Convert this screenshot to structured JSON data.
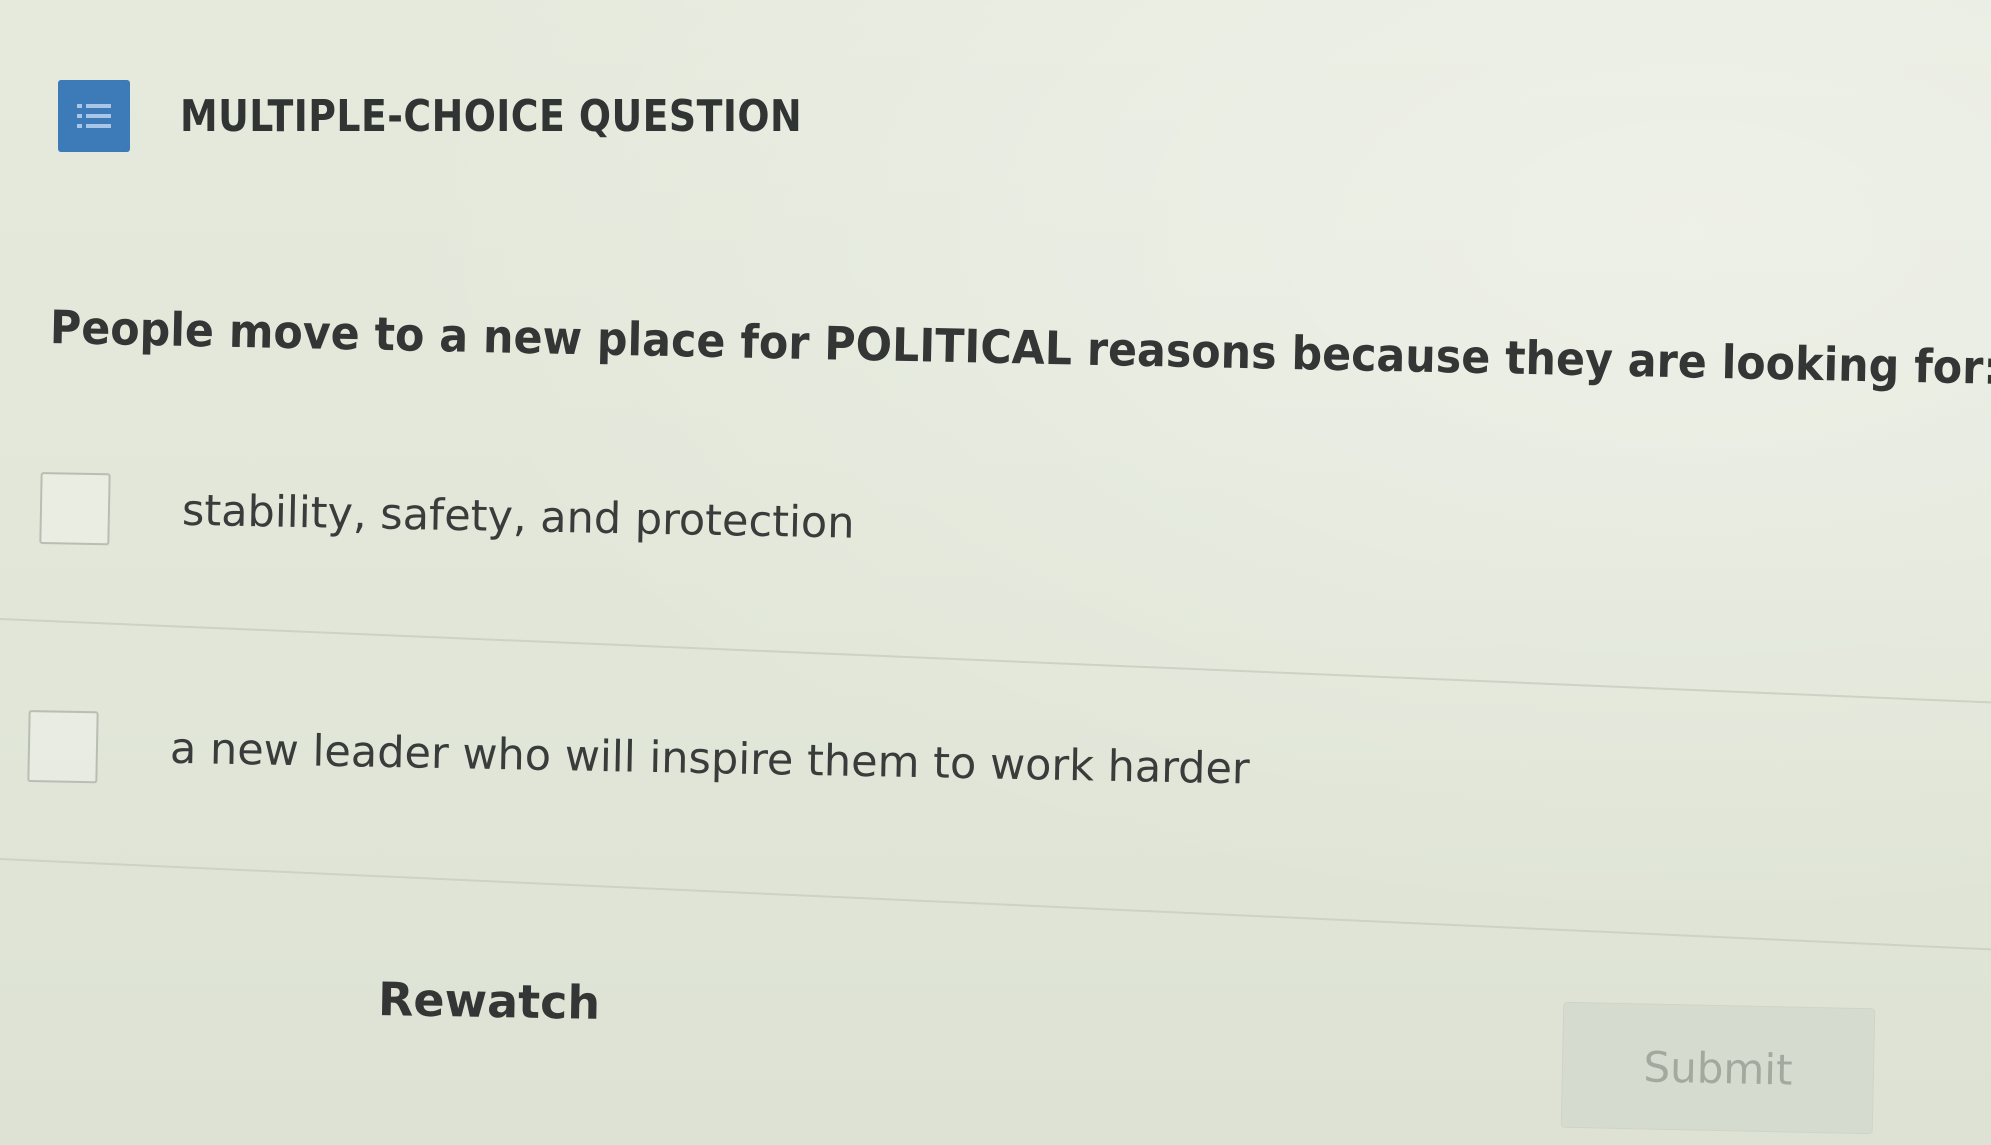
{
  "header": {
    "icon": "list-icon",
    "title": "MULTIPLE-CHOICE QUESTION"
  },
  "question": {
    "text": "People move to a new place for POLITICAL reasons because they are looking for:"
  },
  "options": [
    {
      "label": "stability, safety, and protection",
      "checked": false
    },
    {
      "label": "a new leader who will inspire them to work harder",
      "checked": false
    }
  ],
  "actions": {
    "rewatch_label": "Rewatch",
    "submit_label": "Submit",
    "submit_enabled": false
  },
  "colors": {
    "accent": "#3d7ab8",
    "background": "#e3e8da",
    "submit_disabled_bg": "#d6dbcf",
    "submit_disabled_text": "#a4a9a0"
  }
}
